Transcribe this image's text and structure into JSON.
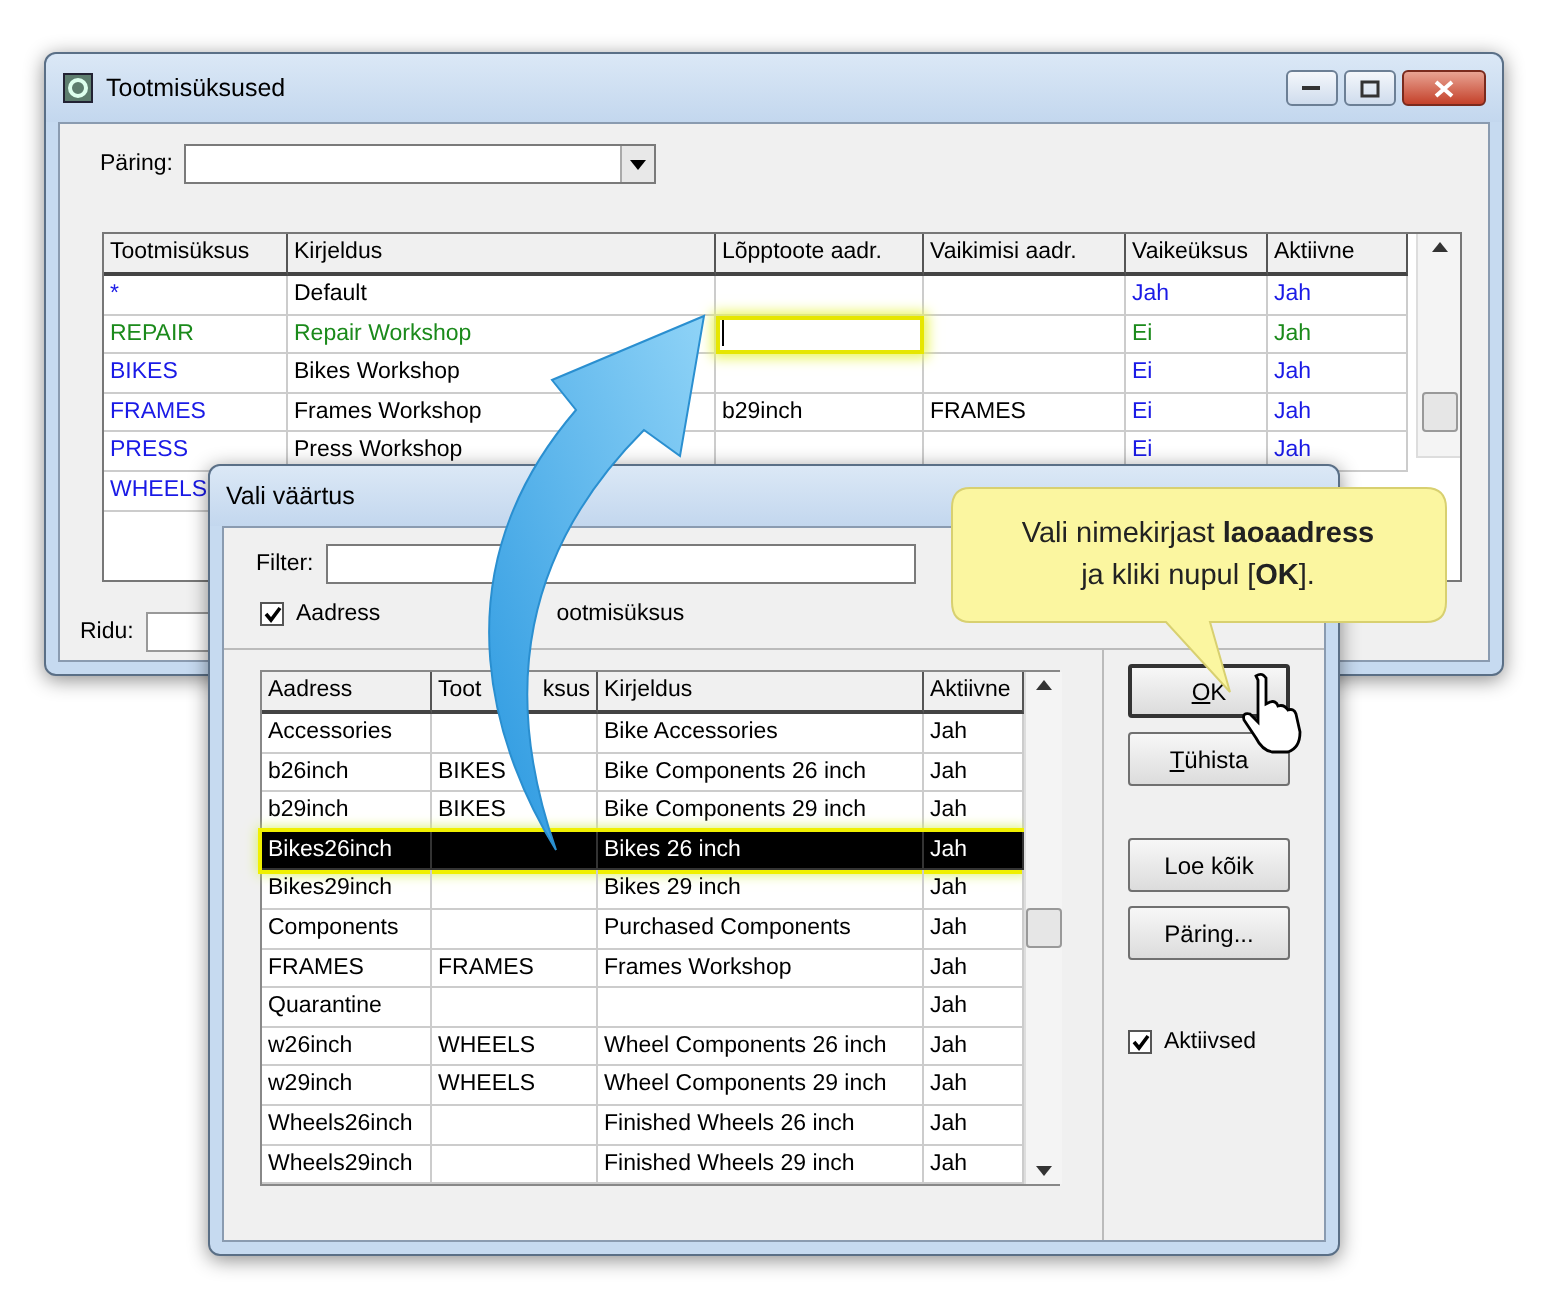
{
  "main_window": {
    "title": "Tootmisüksused",
    "query_label": "Päring:",
    "table": {
      "columns": [
        "Tootmisüksus",
        "Kirjeldus",
        "Lõpptoote aadr.",
        "Vaikimisi aadr.",
        "Vaikeüksus",
        "Aktiivne"
      ],
      "rows": [
        {
          "cells": [
            "*",
            "Default",
            "",
            "",
            "Jah",
            "Jah"
          ],
          "selected": false,
          "editing": false
        },
        {
          "cells": [
            "REPAIR",
            "Repair Workshop",
            "",
            "",
            "Ei",
            "Jah"
          ],
          "selected": true,
          "editing": true
        },
        {
          "cells": [
            "BIKES",
            "Bikes Workshop",
            "",
            "",
            "Ei",
            "Jah"
          ],
          "selected": false,
          "editing": false
        },
        {
          "cells": [
            "FRAMES",
            "Frames Workshop",
            "b29inch",
            "FRAMES",
            "Ei",
            "Jah"
          ],
          "selected": false,
          "editing": false
        },
        {
          "cells": [
            "PRESS",
            "Press Workshop",
            "",
            "",
            "Ei",
            "Jah"
          ],
          "selected": false,
          "editing": false
        },
        {
          "cells": [
            "WHEELS"
          ],
          "selected": false
        }
      ]
    },
    "status_label": "Ridu:"
  },
  "dialog": {
    "title": "Vali väärtus",
    "filter_label": "Filter:",
    "options": [
      {
        "kind": "checkbox",
        "label": "Aadress",
        "checked": true
      },
      {
        "kind": "label",
        "label": "ootmisüksus"
      }
    ],
    "table": {
      "columns": [
        {
          "label": "Aadress"
        },
        {
          "label": "Toot",
          "label_end": "ksus"
        },
        {
          "label": "Kirjeldus"
        },
        {
          "label": "Aktiivne"
        }
      ],
      "rows": [
        {
          "cells": [
            "Accessories",
            "",
            "Bike Accessories",
            "Jah"
          ],
          "selected": false
        },
        {
          "cells": [
            "b26inch",
            "BIKES",
            "Bike Components 26 inch",
            "Jah"
          ],
          "selected": false
        },
        {
          "cells": [
            "b29inch",
            "BIKES",
            "Bike Components 29 inch",
            "Jah"
          ],
          "selected": false
        },
        {
          "cells": [
            "Bikes26inch",
            "",
            "Bikes 26 inch",
            "Jah"
          ],
          "selected": true
        },
        {
          "cells": [
            "Bikes29inch",
            "",
            "Bikes 29 inch",
            "Jah"
          ],
          "selected": false
        },
        {
          "cells": [
            "Components",
            "",
            "Purchased Components",
            "Jah"
          ],
          "selected": false
        },
        {
          "cells": [
            "FRAMES",
            "FRAMES",
            "Frames Workshop",
            "Jah"
          ],
          "selected": false
        },
        {
          "cells": [
            "Quarantine",
            "",
            "",
            "Jah"
          ],
          "selected": false
        },
        {
          "cells": [
            "w26inch",
            "WHEELS",
            "Wheel Components 26 inch",
            "Jah"
          ],
          "selected": false
        },
        {
          "cells": [
            "w29inch",
            "WHEELS",
            "Wheel Components 29 inch",
            "Jah"
          ],
          "selected": false
        },
        {
          "cells": [
            "Wheels26inch",
            "",
            "Finished Wheels 26 inch",
            "Jah"
          ],
          "selected": false
        },
        {
          "cells": [
            "Wheels29inch",
            "",
            "Finished Wheels 29 inch",
            "Jah"
          ],
          "selected": false
        }
      ]
    },
    "buttons": [
      {
        "label": "OK",
        "underline_first": true,
        "default": true
      },
      {
        "label": "Tühista",
        "underline_first": true,
        "default": false
      },
      {
        "label": "Loe kõik",
        "underline_first": false,
        "default": false
      },
      {
        "label": "Päring...",
        "underline_first": false,
        "default": false
      }
    ],
    "active_only": {
      "label": "Aktiivsed",
      "checked": true
    }
  },
  "callout": {
    "lines": [
      "Vali nimekirjast **laoaadress**",
      "ja kliki nupul [**OK**]."
    ]
  }
}
